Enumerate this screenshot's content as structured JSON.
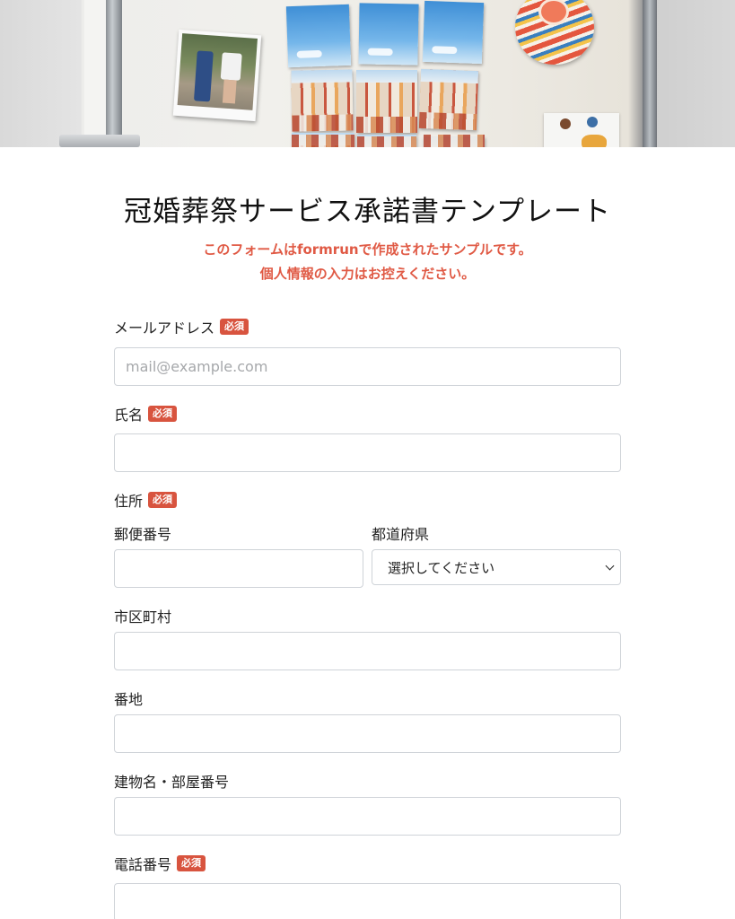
{
  "form": {
    "title": "冠婚葬祭サービス承諾書テンプレート",
    "notice_line1": "このフォームはformrunで作成されたサンプルです。",
    "notice_line2": "個人情報の入力はお控えください。",
    "required_badge": "必須",
    "email": {
      "label": "メールアドレス",
      "placeholder": "mail@example.com",
      "value": ""
    },
    "name": {
      "label": "氏名",
      "value": ""
    },
    "address": {
      "label": "住所",
      "postal_code": {
        "label": "郵便番号",
        "value": ""
      },
      "prefecture": {
        "label": "都道府県",
        "selected": "選択してください"
      },
      "city": {
        "label": "市区町村",
        "value": ""
      },
      "street": {
        "label": "番地",
        "value": ""
      },
      "building": {
        "label": "建物名・部屋番号",
        "value": ""
      }
    },
    "phone": {
      "label": "電話番号",
      "value": ""
    }
  },
  "icons": {
    "select_arrow": "chevron-down-icon"
  }
}
